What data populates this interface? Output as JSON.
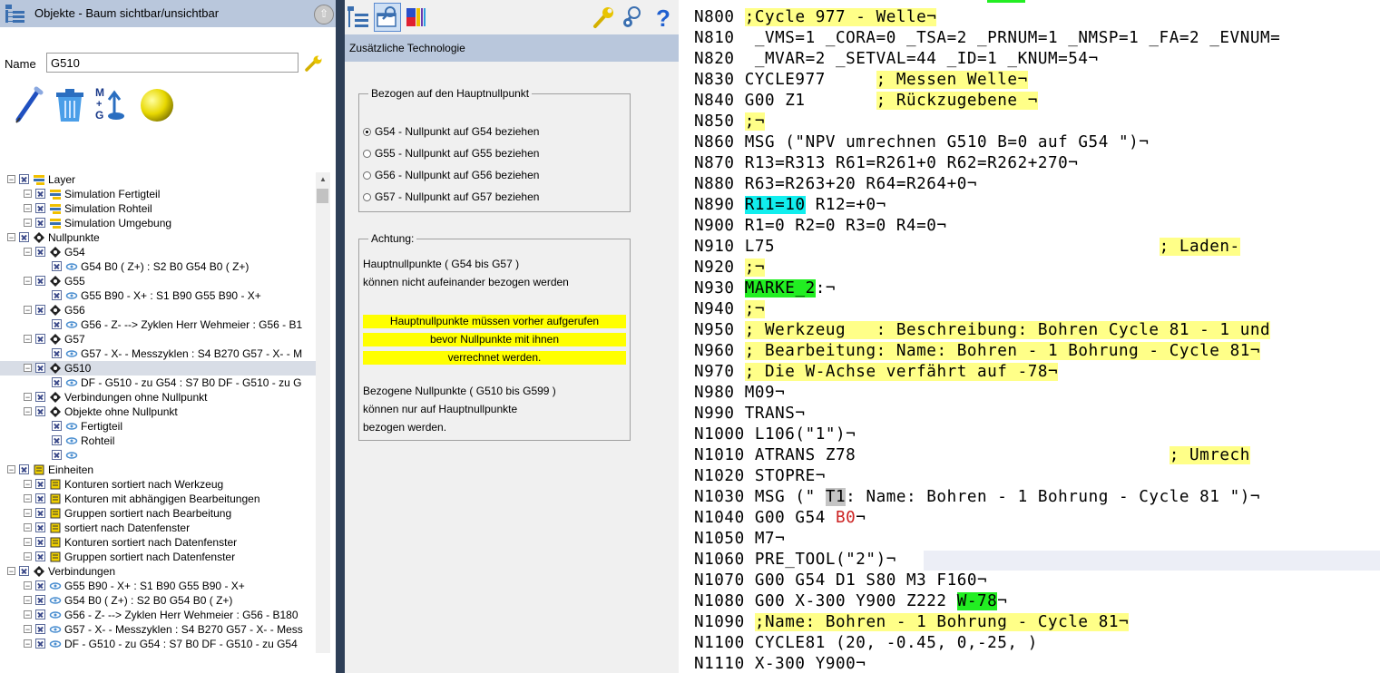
{
  "left_panel": {
    "title": "Objekte - Baum  sichtbar/unsichtbar",
    "name_label": "Name",
    "name_value": "G510",
    "tree": [
      {
        "label": "Layer",
        "level": 0
      },
      {
        "label": "Simulation Fertigteil",
        "level": 1
      },
      {
        "label": "Simulation Rohteil",
        "level": 1
      },
      {
        "label": "Simulation Umgebung",
        "level": 1
      },
      {
        "label": "Nullpunkte",
        "level": 0
      },
      {
        "label": "G54",
        "level": 1
      },
      {
        "label": "G54 B0 ( Z+) : S2  B0  G54 B0 ( Z+)",
        "level": 2
      },
      {
        "label": "G55",
        "level": 1
      },
      {
        "label": "G55 B90 - X+ : S1  B90  G55 B90 - X+",
        "level": 2
      },
      {
        "label": "G56",
        "level": 1
      },
      {
        "label": "G56 - Z-  --> Zyklen Herr Wehmeier : G56 - B1",
        "level": 2
      },
      {
        "label": "G57",
        "level": 1
      },
      {
        "label": "G57 - X- - Messzyklen : S4  B270  G57 - X- - M",
        "level": 2
      },
      {
        "label": "G510",
        "level": 1,
        "selected": true
      },
      {
        "label": "DF - G510 - zu G54 : S7  B0  DF - G510 - zu G",
        "level": 2
      },
      {
        "label": "Verbindungen ohne Nullpunkt",
        "level": 1
      },
      {
        "label": "Objekte ohne Nullpunkt",
        "level": 1
      },
      {
        "label": "Fertigteil",
        "level": 2
      },
      {
        "label": "Rohteil",
        "level": 2
      },
      {
        "label": "",
        "level": 2
      },
      {
        "label": "Einheiten",
        "level": 0
      },
      {
        "label": "Konturen sortiert nach Werkzeug",
        "level": 1
      },
      {
        "label": "Konturen mit abhängigen Bearbeitungen",
        "level": 1
      },
      {
        "label": "Gruppen sortiert nach Bearbeitung",
        "level": 1
      },
      {
        "label": "sortiert nach Datenfenster",
        "level": 1
      },
      {
        "label": "Konturen sortiert nach Datenfenster",
        "level": 1
      },
      {
        "label": "Gruppen sortiert nach Datenfenster",
        "level": 1
      },
      {
        "label": "Verbindungen",
        "level": 0
      },
      {
        "label": "G55 B90 - X+ : S1  B90  G55 B90 - X+",
        "level": 1
      },
      {
        "label": "G54 B0 ( Z+) : S2  B0  G54 B0 ( Z+)",
        "level": 1
      },
      {
        "label": "G56 - Z-  --> Zyklen Herr Wehmeier : G56 - B180",
        "level": 1
      },
      {
        "label": "G57 - X- - Messzyklen : S4  B270  G57 - X- - Mess",
        "level": 1
      },
      {
        "label": "DF - G510 - zu G54 : S7  B0  DF - G510 - zu G54",
        "level": 1
      }
    ]
  },
  "middle_panel": {
    "header": "Zusätzliche Technologie",
    "group1_title": "Bezogen auf den Hauptnullpunkt",
    "radios": [
      {
        "label": "G54 - Nullpunkt auf G54 beziehen",
        "checked": true
      },
      {
        "label": "G55 - Nullpunkt auf G55 beziehen",
        "checked": false
      },
      {
        "label": "G56 - Nullpunkt auf G56 beziehen",
        "checked": false
      },
      {
        "label": "G57 - Nullpunkt auf G57 beziehen",
        "checked": false
      }
    ],
    "group2_title": "Achtung:",
    "note_line1": "Hauptnullpunkte ( G54 bis G57 )",
    "note_line2": "können nicht aufeinander bezogen werden",
    "warning_lines": [
      "Hauptnullpunkte müssen vorher aufgerufen",
      "bevor Nullpunkte mit ihnen",
      "verrechnet werden."
    ],
    "note_line3": "Bezogene Nullpunkte ( G510 bis G599 )",
    "note_line4": "können nur auf Hauptnullpunkte",
    "note_line5": "bezogen werden."
  },
  "code": {
    "lines": [
      {
        "num": "N800",
        "segs": [
          [
            "",
            " "
          ],
          [
            "y",
            ";Cycle 977 - Welle¬"
          ]
        ]
      },
      {
        "num": "N810",
        "segs": [
          [
            "",
            "  _VMS=1 _CORA=0 _TSA=2 _PRNUM=1 _NMSP=1 _FA=2 _EVNUM="
          ]
        ]
      },
      {
        "num": "N820",
        "segs": [
          [
            "",
            "  _MVAR=2 _SETVAL=44 _ID=1 _KNUM=54¬"
          ]
        ]
      },
      {
        "num": "N830",
        "segs": [
          [
            "",
            " CYCLE977     "
          ],
          [
            "y",
            "; Messen Welle¬"
          ]
        ]
      },
      {
        "num": "N840",
        "segs": [
          [
            "",
            " G00 Z1       "
          ],
          [
            "y",
            "; Rückzugebene ¬"
          ]
        ]
      },
      {
        "num": "N850",
        "segs": [
          [
            "",
            " "
          ],
          [
            "y",
            ";¬"
          ]
        ]
      },
      {
        "num": "N860",
        "segs": [
          [
            "",
            " MSG (\"NPV umrechnen G510 B=0 auf G54 \")¬"
          ]
        ]
      },
      {
        "num": "N870",
        "segs": [
          [
            "",
            " R13=R313 R61=R261+0 R62=R262+270¬"
          ]
        ]
      },
      {
        "num": "N880",
        "segs": [
          [
            "",
            " R63=R263+20 R64=R264+0¬"
          ]
        ]
      },
      {
        "num": "N890",
        "segs": [
          [
            "",
            " "
          ],
          [
            "c",
            "R11=10"
          ],
          [
            "",
            " R12=+0¬"
          ]
        ]
      },
      {
        "num": "N900",
        "segs": [
          [
            "",
            " R1=0 R2=0 R3=0 R4=0¬"
          ]
        ]
      },
      {
        "num": "N910",
        "segs": [
          [
            "",
            " L75                                      "
          ],
          [
            "y",
            "; Laden-"
          ]
        ]
      },
      {
        "num": "N920",
        "segs": [
          [
            "",
            " "
          ],
          [
            "y",
            ";¬"
          ]
        ]
      },
      {
        "num": "N930",
        "segs": [
          [
            "",
            " "
          ],
          [
            "g",
            "MARKE_2"
          ],
          [
            "",
            ":¬"
          ]
        ]
      },
      {
        "num": "N940",
        "segs": [
          [
            "",
            " "
          ],
          [
            "y",
            ";¬"
          ]
        ]
      },
      {
        "num": "N950",
        "segs": [
          [
            "",
            " "
          ],
          [
            "y",
            "; Werkzeug   : Beschreibung: Bohren Cycle 81 - 1 und"
          ]
        ]
      },
      {
        "num": "N960",
        "segs": [
          [
            "",
            " "
          ],
          [
            "y",
            "; Bearbeitung: Name: Bohren - 1 Bohrung - Cycle 81¬"
          ]
        ]
      },
      {
        "num": "N970",
        "segs": [
          [
            "",
            " "
          ],
          [
            "y",
            "; Die W-Achse verfährt auf -78¬"
          ]
        ]
      },
      {
        "num": "N980",
        "segs": [
          [
            "",
            " M09¬"
          ]
        ]
      },
      {
        "num": "N990",
        "segs": [
          [
            "",
            " TRANS¬"
          ]
        ]
      },
      {
        "num": "N1000",
        "segs": [
          [
            "",
            " L106(\"1\")¬"
          ]
        ]
      },
      {
        "num": "N1010",
        "segs": [
          [
            "",
            " ATRANS Z78                               "
          ],
          [
            "y",
            "; Umrech"
          ]
        ]
      },
      {
        "num": "N1020",
        "segs": [
          [
            "",
            " STOPRE¬"
          ]
        ]
      },
      {
        "num": "N1030",
        "segs": [
          [
            "",
            " MSG (\" "
          ],
          [
            "gr",
            "T1"
          ],
          [
            "",
            ": Name: Bohren - 1 Bohrung - Cycle 81 \")¬"
          ]
        ]
      },
      {
        "num": "N1040",
        "segs": [
          [
            "",
            " G00 G54 "
          ],
          [
            "r",
            "B0"
          ],
          [
            "",
            "¬"
          ]
        ]
      },
      {
        "num": "N1050",
        "segs": [
          [
            "",
            " M7¬"
          ]
        ]
      },
      {
        "num": "N1060",
        "segs": [
          [
            "",
            " PRE_TOOL(\"2\")¬"
          ]
        ]
      },
      {
        "num": "N1070",
        "segs": [
          [
            "",
            " G00 G54 D1 S80 M3 F160¬"
          ]
        ]
      },
      {
        "num": "N1080",
        "segs": [
          [
            "",
            " G00 X-300 Y900 Z222 "
          ],
          [
            "g",
            "W-78"
          ],
          [
            "",
            "¬"
          ]
        ]
      },
      {
        "num": "N1090",
        "segs": [
          [
            "",
            " "
          ],
          [
            "y",
            ";Name: Bohren - 1 Bohrung - Cycle 81¬"
          ]
        ]
      },
      {
        "num": "N1100",
        "segs": [
          [
            "",
            " CYCLE81 (20, -0.45, 0,-25, )"
          ]
        ]
      },
      {
        "num": "N1110",
        "segs": [
          [
            "",
            " X-300 Y900¬"
          ]
        ]
      }
    ]
  }
}
